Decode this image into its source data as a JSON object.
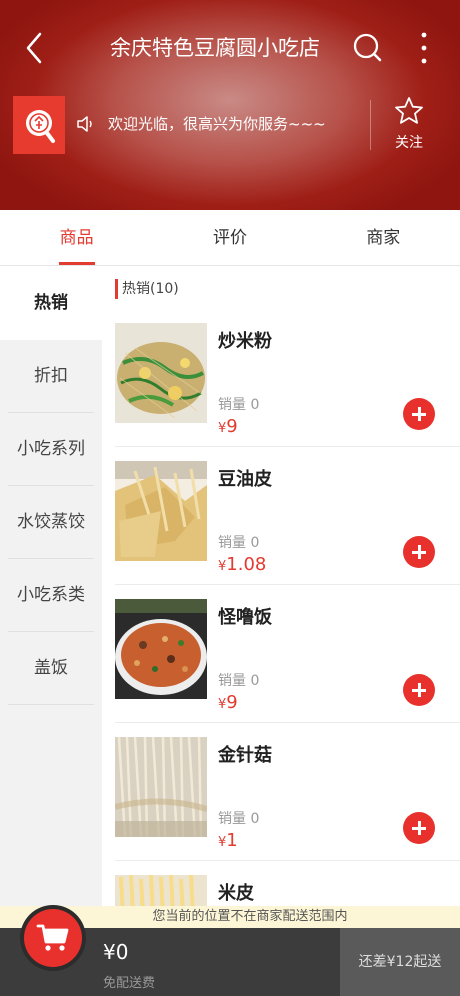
{
  "header": {
    "title": "余庆特色豆腐圆小吃店",
    "notice": "欢迎光临，很高兴为你服务~~~",
    "follow_label": "关注"
  },
  "tabs": [
    {
      "label": "商品",
      "active": true
    },
    {
      "label": "评价",
      "active": false
    },
    {
      "label": "商家",
      "active": false
    }
  ],
  "sidebar": {
    "items": [
      {
        "label": "热销",
        "active": true
      },
      {
        "label": "折扣"
      },
      {
        "label": "小吃系列"
      },
      {
        "label": "水饺蒸饺"
      },
      {
        "label": "小吃系类"
      },
      {
        "label": "盖饭"
      }
    ]
  },
  "section": {
    "title": "热销(10)"
  },
  "products": [
    {
      "name": "炒米粉",
      "sales": "销量 0",
      "currency": "¥",
      "price": "9"
    },
    {
      "name": "豆油皮",
      "sales": "销量 0",
      "currency": "¥",
      "price": "1.08"
    },
    {
      "name": "怪噜饭",
      "sales": "销量 0",
      "currency": "¥",
      "price": "9"
    },
    {
      "name": "金针菇",
      "sales": "销量 0",
      "currency": "¥",
      "price": "1"
    },
    {
      "name": "米皮"
    }
  ],
  "warning": "您当前的位置不在商家配送范围内",
  "cart": {
    "total": "¥0",
    "delivery": "免配送费",
    "checkout": "还差¥12起送"
  },
  "colors": {
    "accent": "#e23b30",
    "header_red": "#9f1f17",
    "bottom_bar": "#3c3c3c"
  }
}
